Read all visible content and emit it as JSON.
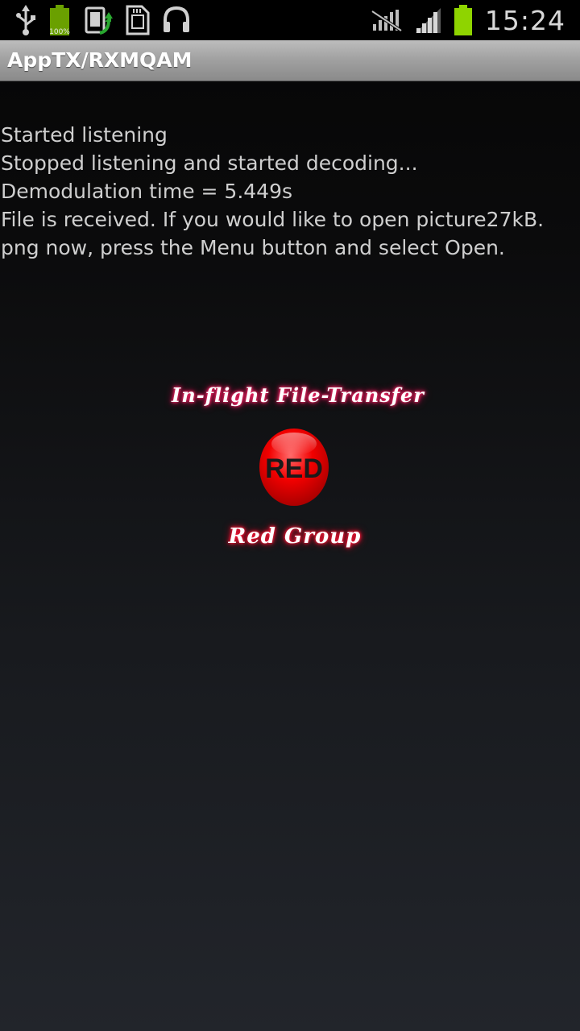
{
  "status_bar": {
    "left_icons": [
      "usb-icon",
      "battery-full-icon",
      "sync-icon",
      "sd-card-icon",
      "headphones-icon"
    ],
    "battery_notification_label": "100%",
    "right_icons": [
      "no-signal-bars-icon",
      "cell-signal-icon",
      "battery-icon"
    ],
    "clock": "15:24",
    "battery_color": "#8fd400"
  },
  "app": {
    "title": "AppTX/RXMQAM"
  },
  "log": {
    "lines": [
      "Started listening",
      "Stopped listening and started decoding...",
      "Demodulation time = 5.449s",
      "File is received. If you would like to open picture27kB.",
      "png now, press the Menu button and select Open."
    ]
  },
  "branding": {
    "title": "In-flight File-Transfer",
    "logo_text": "RED",
    "subtitle": "Red Group",
    "accent_color": "#ff2a6a",
    "logo_color": "#e00000"
  }
}
